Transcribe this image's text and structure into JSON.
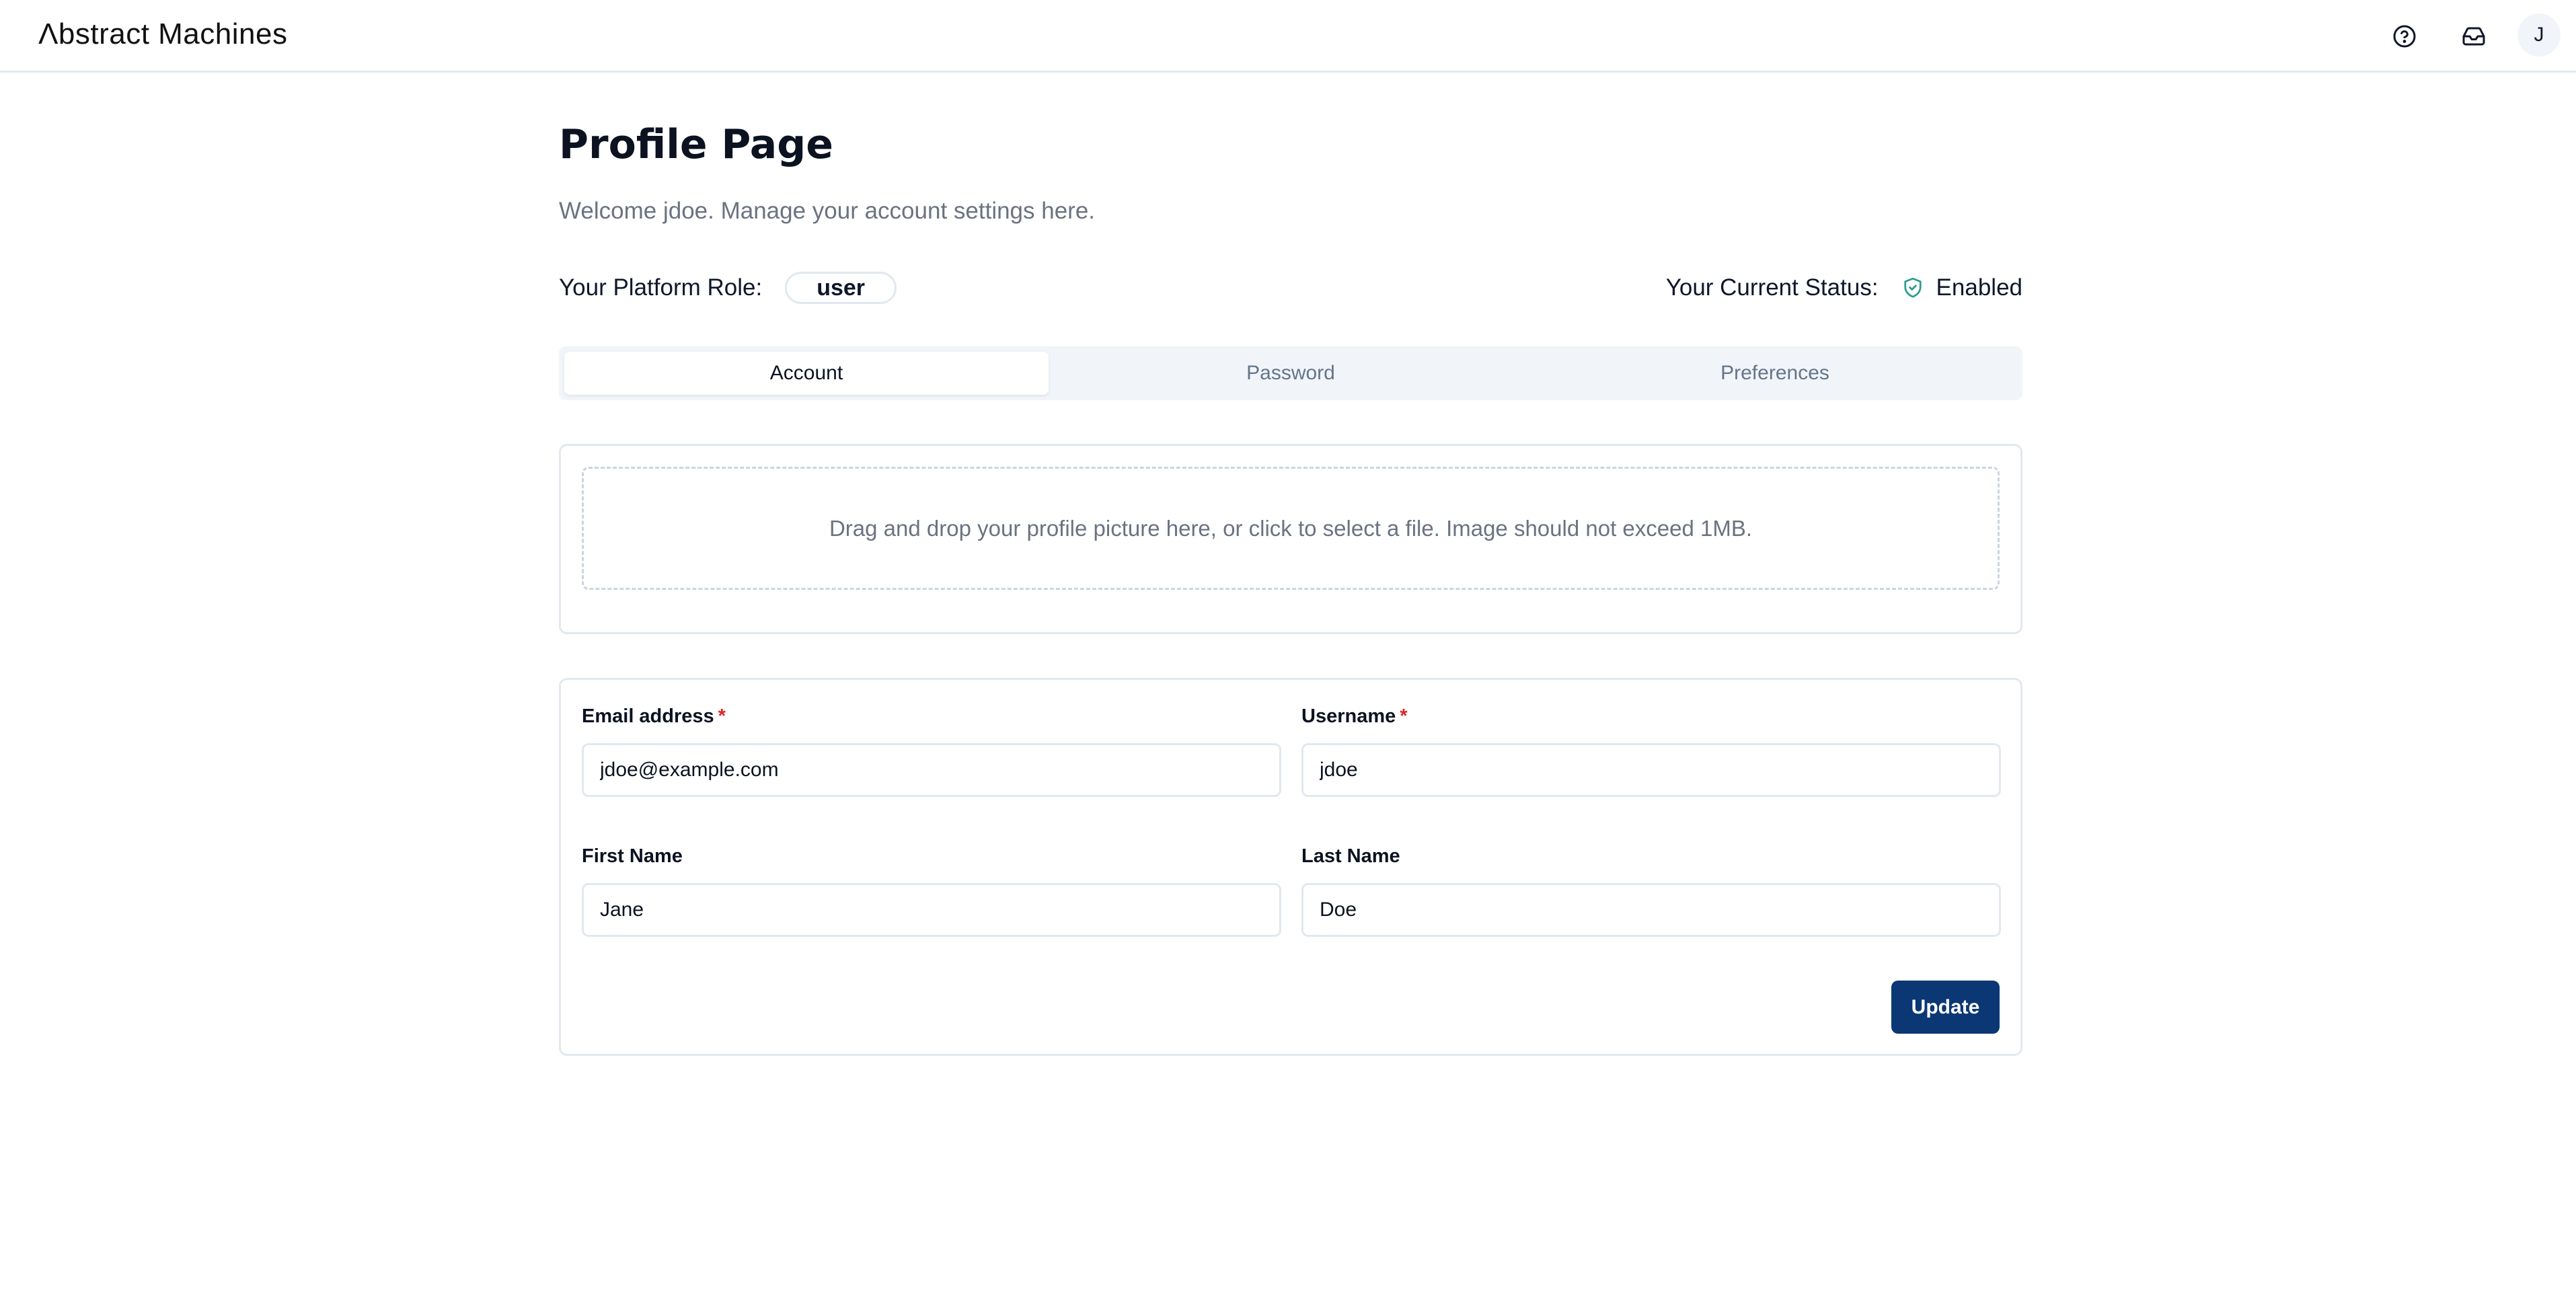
{
  "header": {
    "logo": "Λbstract Machines",
    "help_icon": "help-circle-icon",
    "inbox_icon": "inbox-icon",
    "avatar_initial": "J"
  },
  "page": {
    "title": "Profile Page",
    "subtitle": "Welcome jdoe. Manage your account settings here."
  },
  "role": {
    "label": "Your Platform Role:",
    "value": "user"
  },
  "status": {
    "label": "Your Current Status:",
    "icon": "shield-check-icon",
    "value": "Enabled",
    "color": "#2a9d8f"
  },
  "tabs": [
    {
      "label": "Account",
      "active": true
    },
    {
      "label": "Password",
      "active": false
    },
    {
      "label": "Preferences",
      "active": false
    }
  ],
  "upload": {
    "text": "Drag and drop your profile picture here, or click to select a file. Image should not exceed 1MB."
  },
  "form": {
    "fields": [
      {
        "label": "Email address",
        "required": true,
        "value": "jdoe@example.com"
      },
      {
        "label": "Username",
        "required": true,
        "value": "jdoe"
      },
      {
        "label": "First Name",
        "required": false,
        "value": "Jane"
      },
      {
        "label": "Last Name",
        "required": false,
        "value": "Doe"
      }
    ],
    "required_marker": "*",
    "submit_label": "Update",
    "submit_color": "#0b3875"
  }
}
